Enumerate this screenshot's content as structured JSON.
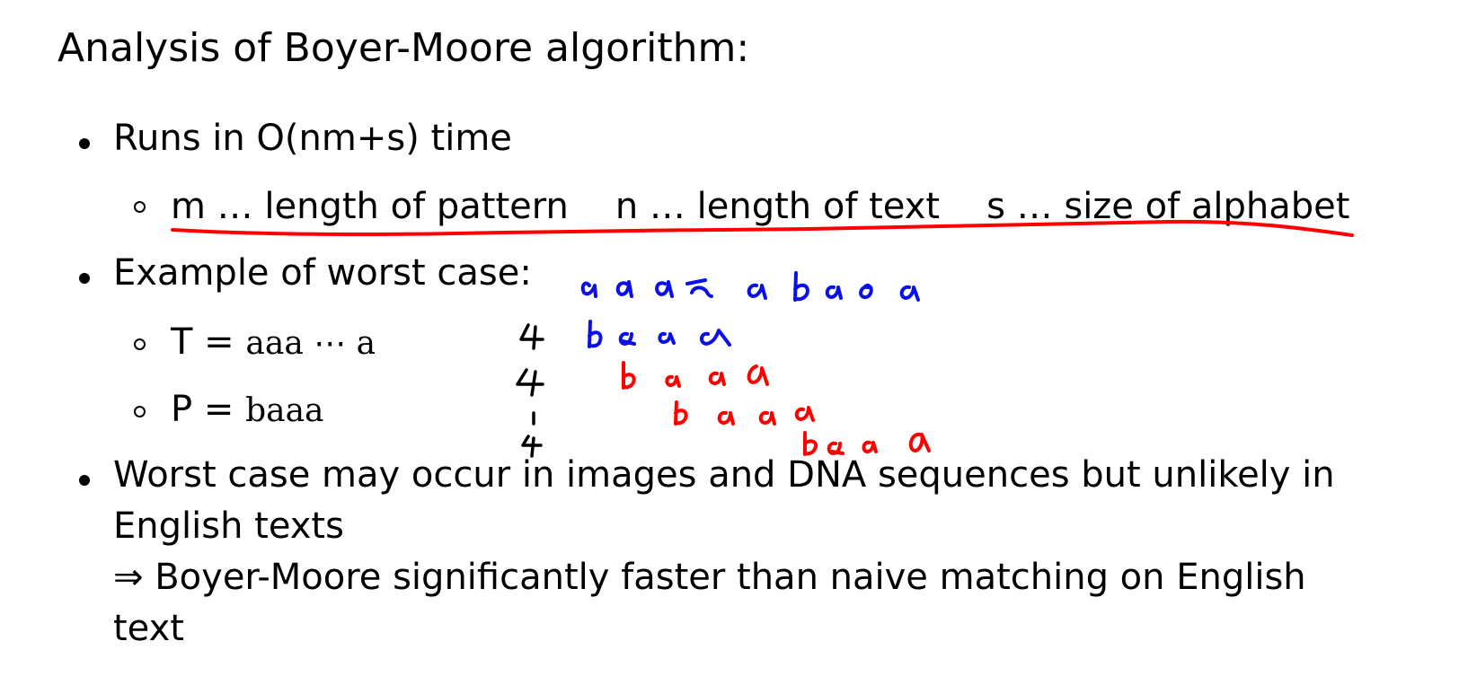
{
  "title": "Analysis of Boyer-Moore algorithm:",
  "bullets": {
    "runs": "Runs in O(nm+s) time",
    "defs": {
      "m": "m … length of pattern",
      "n": "n … length of text",
      "s": "s … size of alphabet"
    },
    "example": "Example of worst case:",
    "t_label": "T = ",
    "t_value": "aaa ⋯ a",
    "p_label": "P = ",
    "p_value": "baaa",
    "worst_line1": "Worst case may occur in images and DNA sequences but unlikely in",
    "worst_line2": "English texts",
    "conclusion_line1": "⇒ Boyer-Moore significantly faster than naive matching on English",
    "conclusion_line2": "text"
  },
  "annotations": {
    "text_row": "aaaaabaaa",
    "pattern_rows": [
      "baaa",
      "baaa",
      "baaa",
      "baaa"
    ],
    "shift_values": [
      "4",
      "4",
      "⋮",
      "4"
    ],
    "ink_colors": {
      "underline": "#ff0000",
      "text": "#0a10ea",
      "pattern": "#ff0000",
      "shift": "#000000"
    }
  }
}
